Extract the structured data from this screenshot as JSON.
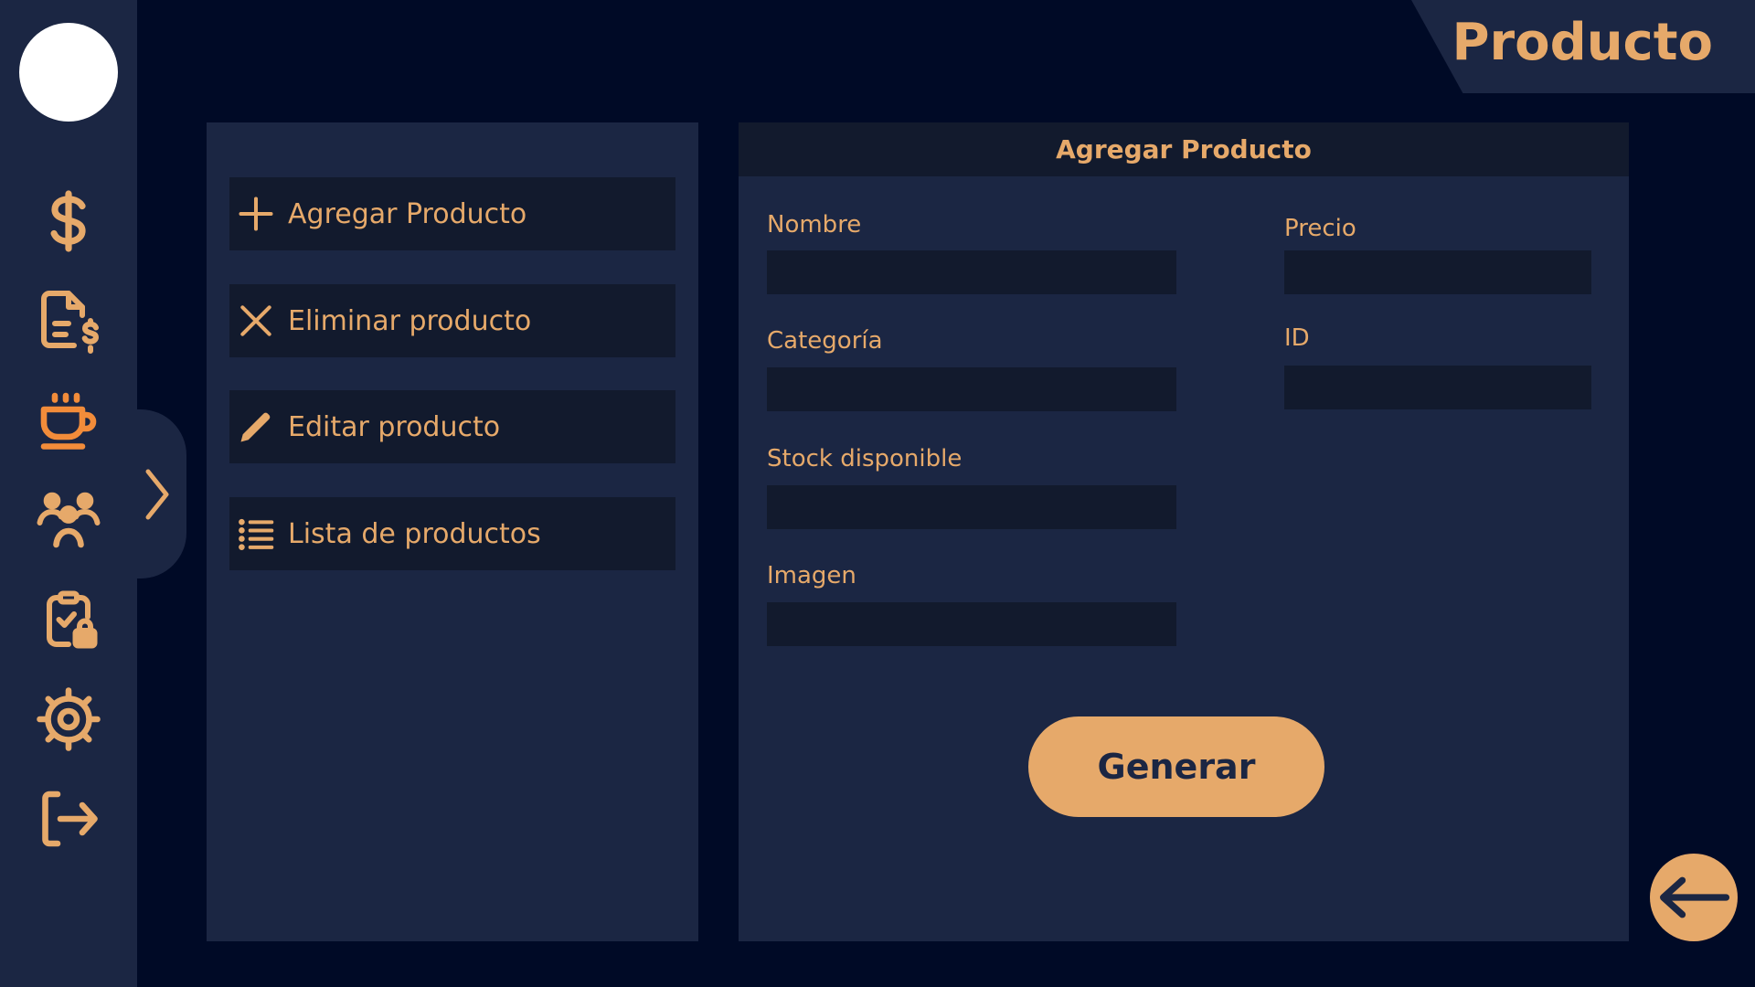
{
  "header": {
    "title": "Producto"
  },
  "sidebar": {
    "icons": [
      {
        "name": "dollar-icon"
      },
      {
        "name": "invoice-icon"
      },
      {
        "name": "coffee-cup-icon"
      },
      {
        "name": "users-icon"
      },
      {
        "name": "clipboard-lock-icon"
      },
      {
        "name": "settings-icon"
      },
      {
        "name": "logout-icon"
      }
    ],
    "active_color": "#f28c3a",
    "icon_color": "#e6a96a"
  },
  "menu": {
    "items": [
      {
        "label": "Agregar Producto",
        "icon": "plus-icon"
      },
      {
        "label": "Eliminar producto",
        "icon": "close-icon"
      },
      {
        "label": "Editar producto",
        "icon": "pencil-icon"
      },
      {
        "label": "Lista de productos",
        "icon": "list-icon"
      }
    ]
  },
  "form": {
    "title": "Agregar Producto",
    "fields": {
      "nombre": {
        "label": "Nombre",
        "value": ""
      },
      "precio": {
        "label": "Precio",
        "value": ""
      },
      "categoria": {
        "label": "Categoría",
        "value": ""
      },
      "id": {
        "label": "ID",
        "value": ""
      },
      "stock": {
        "label": "Stock disponible",
        "value": ""
      },
      "imagen": {
        "label": "Imagen",
        "value": ""
      }
    },
    "submit_label": "Generar"
  },
  "colors": {
    "background": "#000a26",
    "panel": "#1b2643",
    "field": "#121a2d",
    "accent": "#e6a96a"
  }
}
